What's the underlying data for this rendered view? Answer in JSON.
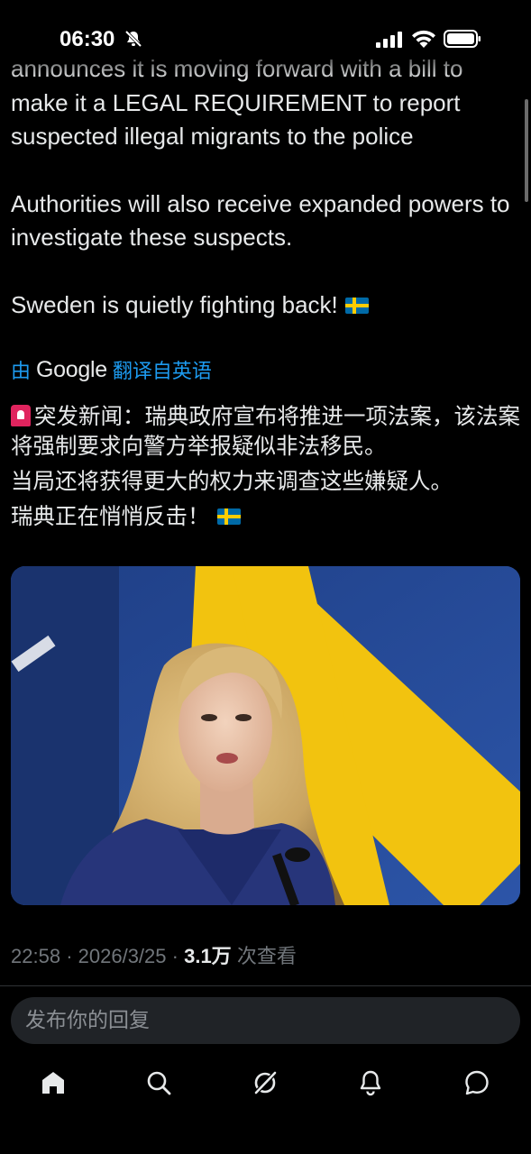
{
  "status_bar": {
    "time": "06:30"
  },
  "tweet": {
    "partial_line": "announces it is moving forward with a bill to",
    "line_1": "make it a LEGAL REQUIREMENT to report",
    "line_2": "suspected illegal migrants to the police",
    "paragraph_2": "Authorities will also receive expanded powers to investigate these suspects.",
    "paragraph_3": "Sweden is quietly fighting back!"
  },
  "translation": {
    "prefix": "由",
    "provider": "Google",
    "suffix": "翻译自英语",
    "paragraph_1": "突发新闻：瑞典政府宣布将推进一项法案，该法案将强制要求向警方举报疑似非法移民。",
    "paragraph_2": "当局还将获得更大的权力来调查这些嫌疑人。",
    "paragraph_3": "瑞典正在悄悄反击！"
  },
  "meta": {
    "time": "22:58",
    "separator": "·",
    "date": "2026/3/25",
    "views_count": "3.1万",
    "views_label": "次查看"
  },
  "reply": {
    "placeholder": "发布你的回复"
  },
  "nav": {
    "items": [
      "home-icon",
      "search-icon",
      "grok-icon",
      "notifications-icon",
      "messages-icon"
    ]
  },
  "colors": {
    "background": "#000000",
    "text": "#e7e9ea",
    "link": "#1d9bf0",
    "muted": "#71767b",
    "flag_blue": "#2a4f9a",
    "flag_yellow": "#f2c30f"
  }
}
